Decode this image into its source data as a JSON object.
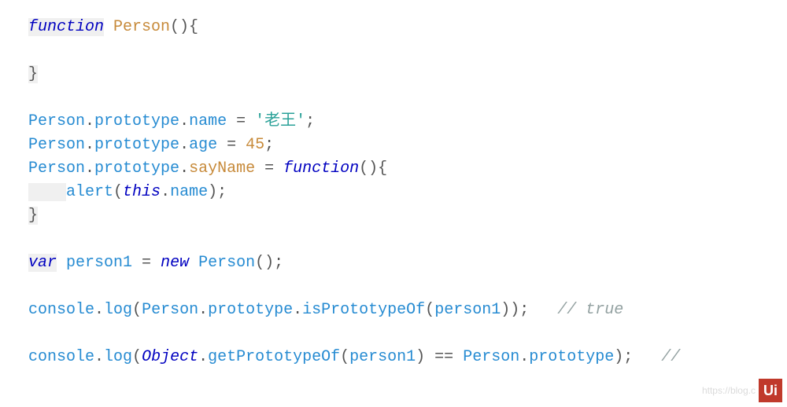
{
  "code": {
    "l1": {
      "kw": "function",
      "fn": "Person",
      "tail": "(){"
    },
    "l2": "",
    "l3": "}",
    "l4": "",
    "l5": {
      "cls": "Person",
      "d1": ".",
      "p1": "prototype",
      "d2": ".",
      "p2": "name",
      "eq": " = ",
      "str": "'老王'",
      "semi": ";"
    },
    "l6": {
      "cls": "Person",
      "d1": ".",
      "p1": "prototype",
      "d2": ".",
      "p2": "age",
      "eq": " = ",
      "num": "45",
      "semi": ";"
    },
    "l7": {
      "cls": "Person",
      "d1": ".",
      "p1": "prototype",
      "d2": ".",
      "method": "sayName",
      "eq": " = ",
      "kw": "function",
      "tail": "(){"
    },
    "l8": {
      "indent": "    ",
      "call": "alert",
      "op": "(",
      "this": "this",
      "d": ".",
      "prop": "name",
      "cp": ");"
    },
    "l9": "}",
    "l10": "",
    "l11": {
      "kw": "var",
      "id": "person1",
      "eq": " = ",
      "new": "new",
      "cls": "Person",
      "tail": "();"
    },
    "l12": "",
    "l13": {
      "obj": "console",
      "d1": ".",
      "m": "log",
      "op": "(",
      "cls": "Person",
      "d2": ".",
      "p1": "prototype",
      "d3": ".",
      "m2": "isPrototypeOf",
      "op2": "(",
      "arg": "person1",
      "cp": "));",
      "sp": "   ",
      "cmt": "// true"
    },
    "l14": "",
    "l15": {
      "obj": "console",
      "d1": ".",
      "m": "log",
      "op": "(",
      "Obj": "Object",
      "d2": ".",
      "m2": "getPrototypeOf",
      "op2": "(",
      "arg": "person1",
      "cp1": ")",
      "eq": " == ",
      "cls": "Person",
      "d3": ".",
      "p1": "prototype",
      "cp2": ");",
      "sp": "   ",
      "cmt": "//"
    }
  },
  "watermark_text": "https://blog.c",
  "watermark_logo": "Ui"
}
